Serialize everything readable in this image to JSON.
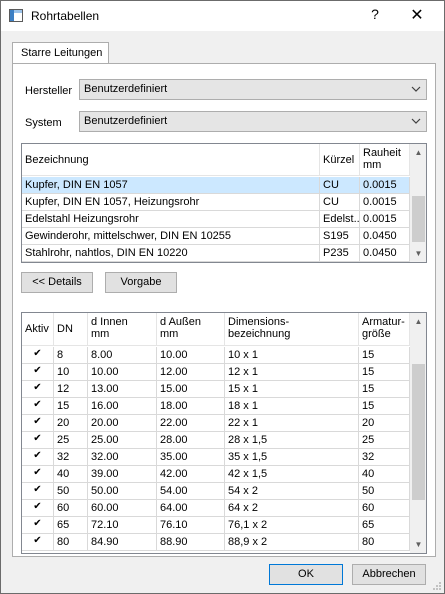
{
  "window": {
    "title": "Rohrtabellen",
    "help_glyph": "?",
    "close_glyph": "✕"
  },
  "tab": {
    "label": "Starre Leitungen"
  },
  "hersteller": {
    "label": "Hersteller",
    "value": "Benutzerdefiniert"
  },
  "system": {
    "label": "System",
    "value": "Benutzerdefiniert"
  },
  "material_table": {
    "headers": [
      "Bezeichnung",
      "Kürzel",
      "Rauheit",
      "mm"
    ],
    "rows": [
      {
        "name": "Kupfer, DIN EN 1057",
        "short": "CU",
        "rough": "0.0015"
      },
      {
        "name": "Kupfer, DIN EN 1057, Heizungsrohr",
        "short": "CU",
        "rough": "0.0015"
      },
      {
        "name": "Edelstahl Heizungsrohr",
        "short": "Edelst...",
        "rough": "0.0015"
      },
      {
        "name": "Gewinderohr, mittelschwer, DIN EN 10255",
        "short": "S195",
        "rough": "0.0450"
      },
      {
        "name": "Stahlrohr, nahtlos, DIN EN 10220",
        "short": "P235",
        "rough": "0.0450"
      }
    ]
  },
  "buttons": {
    "details": "<< Details",
    "vorgabe": "Vorgabe",
    "ok": "OK",
    "abbrechen": "Abbrechen"
  },
  "dn_table": {
    "headers": {
      "aktiv": "Aktiv",
      "dn": "DN",
      "d_innen_1": "d Innen",
      "d_innen_2": "mm",
      "d_aussen_1": "d Außen",
      "d_aussen_2": "mm",
      "dim_1": "Dimensions-",
      "dim_2": "bezeichnung",
      "arm_1": "Armatur-",
      "arm_2": "größe"
    },
    "check_glyph": "✔",
    "rows": [
      {
        "dn": "8",
        "di": "8.00",
        "da": "10.00",
        "dim": "10 x 1",
        "arm": "15"
      },
      {
        "dn": "10",
        "di": "10.00",
        "da": "12.00",
        "dim": "12 x 1",
        "arm": "15"
      },
      {
        "dn": "12",
        "di": "13.00",
        "da": "15.00",
        "dim": "15 x 1",
        "arm": "15"
      },
      {
        "dn": "15",
        "di": "16.00",
        "da": "18.00",
        "dim": "18 x 1",
        "arm": "15"
      },
      {
        "dn": "20",
        "di": "20.00",
        "da": "22.00",
        "dim": "22 x 1",
        "arm": "20"
      },
      {
        "dn": "25",
        "di": "25.00",
        "da": "28.00",
        "dim": "28 x 1,5",
        "arm": "25"
      },
      {
        "dn": "32",
        "di": "32.00",
        "da": "35.00",
        "dim": "35 x 1,5",
        "arm": "32"
      },
      {
        "dn": "40",
        "di": "39.00",
        "da": "42.00",
        "dim": "42 x 1,5",
        "arm": "40"
      },
      {
        "dn": "50",
        "di": "50.00",
        "da": "54.00",
        "dim": "54 x 2",
        "arm": "50"
      },
      {
        "dn": "60",
        "di": "60.00",
        "da": "64.00",
        "dim": "64 x 2",
        "arm": "60"
      },
      {
        "dn": "65",
        "di": "72.10",
        "da": "76.10",
        "dim": "76,1 x 2",
        "arm": "65"
      },
      {
        "dn": "80",
        "di": "84.90",
        "da": "88.90",
        "dim": "88,9 x 2",
        "arm": "80"
      }
    ]
  }
}
